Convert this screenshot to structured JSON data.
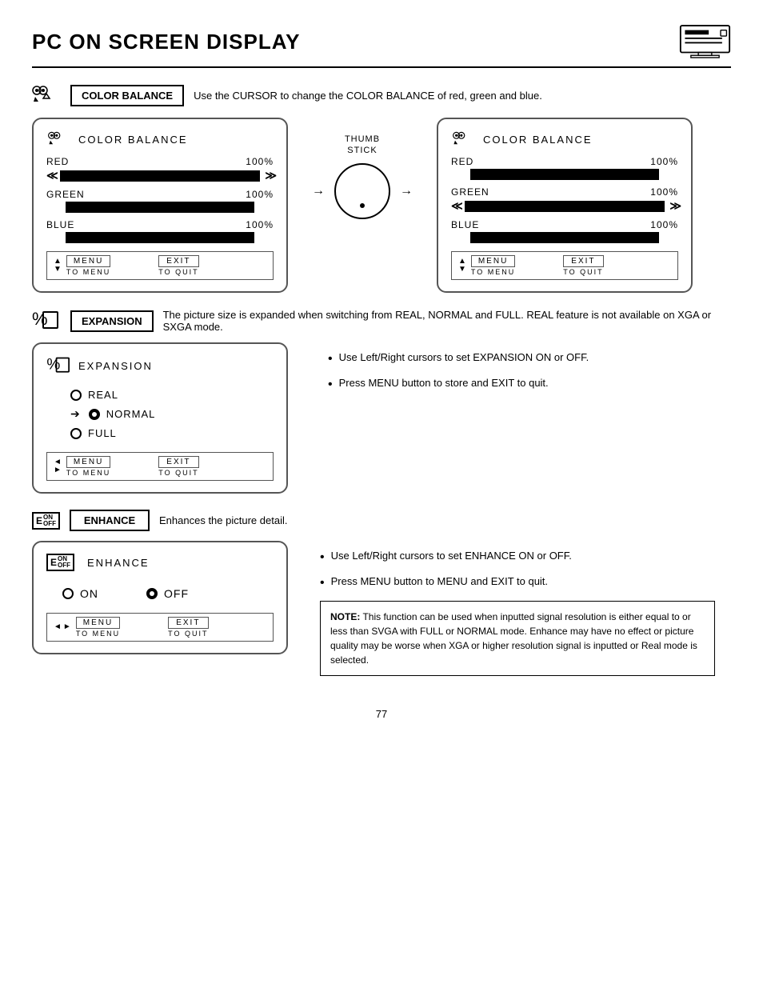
{
  "header": {
    "title": "PC ON SCREEN DISPLAY",
    "page_number": "77"
  },
  "color_balance": {
    "label": "COLOR BALANCE",
    "description": "Use the CURSOR to change the COLOR BALANCE of red, green and blue.",
    "left_osd": {
      "title": "COLOR BALANCE",
      "bars": [
        {
          "label": "RED",
          "percent": "100%",
          "active": false
        },
        {
          "label": "GREEN",
          "percent": "100%",
          "active": true
        },
        {
          "label": "BLUE",
          "percent": "100%",
          "active": false
        }
      ],
      "menu_label": "MENU",
      "menu_sub": "TO MENU",
      "exit_label": "EXIT",
      "exit_sub": "TO QUIT"
    },
    "thumbstick_label": "THUMB\nSTICK",
    "right_osd": {
      "title": "COLOR BALANCE",
      "bars": [
        {
          "label": "RED",
          "percent": "100%",
          "active": false
        },
        {
          "label": "GREEN",
          "percent": "100%",
          "active": true
        },
        {
          "label": "BLUE",
          "percent": "100%",
          "active": false
        }
      ],
      "menu_label": "MENU",
      "menu_sub": "TO MENU",
      "exit_label": "EXIT",
      "exit_sub": "TO QUIT"
    }
  },
  "expansion": {
    "label": "EXPANSION",
    "description": "The picture size is expanded when switching from REAL, NORMAL and FULL.  REAL feature is not available on XGA or SXGA mode.",
    "osd": {
      "title": "EXPANSION",
      "options": [
        {
          "label": "REAL",
          "selected": false
        },
        {
          "label": "NORMAL",
          "selected": true
        },
        {
          "label": "FULL",
          "selected": false
        }
      ],
      "menu_label": "MENU",
      "menu_sub": "TO MENU",
      "exit_label": "EXIT",
      "exit_sub": "TO QUIT"
    },
    "bullets": [
      "Use Left/Right cursors to set EXPANSION ON or OFF.",
      "Press MENU button to store and EXIT to quit."
    ]
  },
  "enhance": {
    "label": "ENHANCE",
    "description": "Enhances the picture detail.",
    "osd": {
      "title": "ENHANCE",
      "options": [
        {
          "label": "ON",
          "selected": false
        },
        {
          "label": "OFF",
          "selected": true
        }
      ],
      "menu_label": "MENU",
      "menu_sub": "TO MENU",
      "exit_label": "EXIT",
      "exit_sub": "TO QUIT"
    },
    "bullets": [
      "Use Left/Right cursors to set ENHANCE ON or OFF.",
      "Press MENU button to MENU and EXIT to quit."
    ],
    "note_prefix": "NOTE:",
    "note_text": "This function can be used when inputted signal resolution is either equal to or less than SVGA with FULL or NORMAL mode.  Enhance may have no effect or picture quality may be worse when XGA or higher resolution signal is inputted or Real mode is selected."
  }
}
